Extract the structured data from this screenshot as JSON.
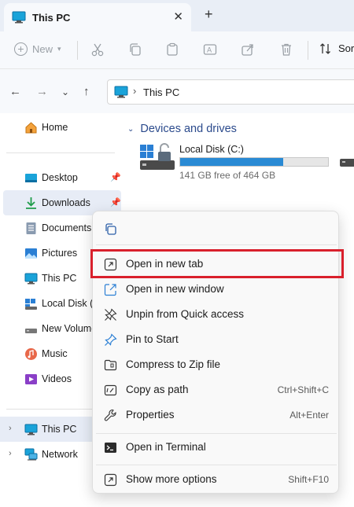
{
  "tab": {
    "title": "This PC",
    "close": "✕",
    "new_tab": "+"
  },
  "toolbar": {
    "new_label": "New",
    "sort_label": "Sor"
  },
  "address": {
    "path": "This PC",
    "separator": "›"
  },
  "sidebar": {
    "home": "Home",
    "pinned": [
      {
        "label": "Desktop",
        "icon": "desktop-icon",
        "pinned": true
      },
      {
        "label": "Downloads",
        "icon": "download-icon",
        "pinned": true
      },
      {
        "label": "Documents",
        "icon": "documents-icon"
      },
      {
        "label": "Pictures",
        "icon": "pictures-icon"
      },
      {
        "label": "This PC",
        "icon": "pc-icon"
      },
      {
        "label": "Local Disk (C",
        "icon": "drive-icon"
      },
      {
        "label": "New Volume",
        "icon": "drive-icon"
      },
      {
        "label": "Music",
        "icon": "music-icon"
      },
      {
        "label": "Videos",
        "icon": "videos-icon"
      }
    ],
    "tree": [
      {
        "label": "This PC",
        "icon": "pc-icon"
      },
      {
        "label": "Network",
        "icon": "network-icon"
      }
    ]
  },
  "main": {
    "section_title": "Devices and drives",
    "drive": {
      "name": "Local Disk (C:)",
      "free_text": "141 GB free of 464 GB",
      "used_fraction": 0.696
    }
  },
  "menu": {
    "items": [
      {
        "label": "Open in new tab",
        "icon": "open-new-tab-icon",
        "shortcut": ""
      },
      {
        "label": "Open in new window",
        "icon": "open-new-window-icon",
        "shortcut": ""
      },
      {
        "label": "Unpin from Quick access",
        "icon": "unpin-icon",
        "shortcut": ""
      },
      {
        "label": "Pin to Start",
        "icon": "pin-icon",
        "shortcut": ""
      },
      {
        "label": "Compress to Zip file",
        "icon": "zip-icon",
        "shortcut": ""
      },
      {
        "label": "Copy as path",
        "icon": "copy-path-icon",
        "shortcut": "Ctrl+Shift+C"
      },
      {
        "label": "Properties",
        "icon": "wrench-icon",
        "shortcut": "Alt+Enter"
      }
    ],
    "terminal": {
      "label": "Open in Terminal",
      "icon": "terminal-icon"
    },
    "more": {
      "label": "Show more options",
      "icon": "more-options-icon",
      "shortcut": "Shift+F10"
    }
  },
  "colors": {
    "accent": "#0067c0",
    "highlight_box": "#d9202c",
    "bar_fill": "#2a8ad4"
  }
}
